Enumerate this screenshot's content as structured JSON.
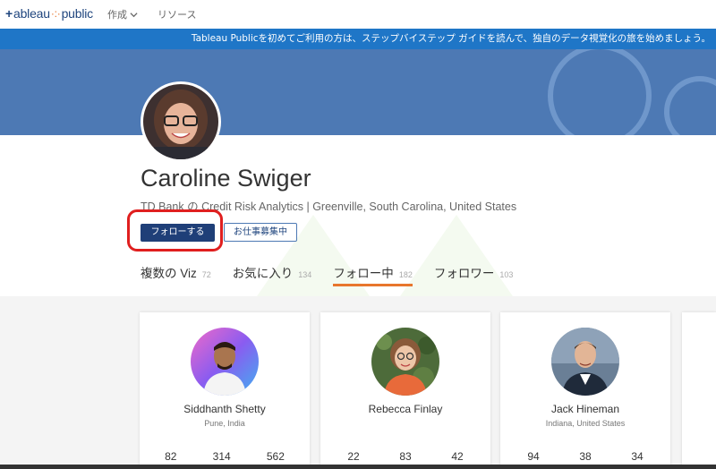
{
  "nav": {
    "logo": "tableau public",
    "create": "作成",
    "resources": "リソース"
  },
  "banner": "Tableau Publicを初めてご利用の方は、ステップバイステップ ガイドを読んで、独自のデータ視覚化の旅を始めましょう。",
  "profile": {
    "name": "Caroline Swiger",
    "subtitle": "TD Bank の Credit Risk Analytics | Greenville, South Carolina, United States",
    "follow_label": "フォローする",
    "hire_label": "お仕事募集中"
  },
  "tabs": [
    {
      "label": "複数の Viz",
      "count": "72"
    },
    {
      "label": "お気に入り",
      "count": "134"
    },
    {
      "label": "フォロー中",
      "count": "182"
    },
    {
      "label": "フォロワー",
      "count": "103"
    }
  ],
  "cards": [
    {
      "name": "Siddhanth Shetty",
      "location": "Pune, India",
      "stats": [
        "82",
        "314",
        "562"
      ]
    },
    {
      "name": "Rebecca Finlay",
      "location": "",
      "stats": [
        "22",
        "83",
        "42"
      ]
    },
    {
      "name": "Jack Hineman",
      "location": "Indiana, United States",
      "stats": [
        "94",
        "38",
        "34"
      ]
    }
  ],
  "colors": {
    "banner": "#1f76c7",
    "band": "#4d79b4",
    "primary_button": "#1f3f78",
    "active_tab": "#e8762d",
    "highlight": "#e01f1f"
  }
}
